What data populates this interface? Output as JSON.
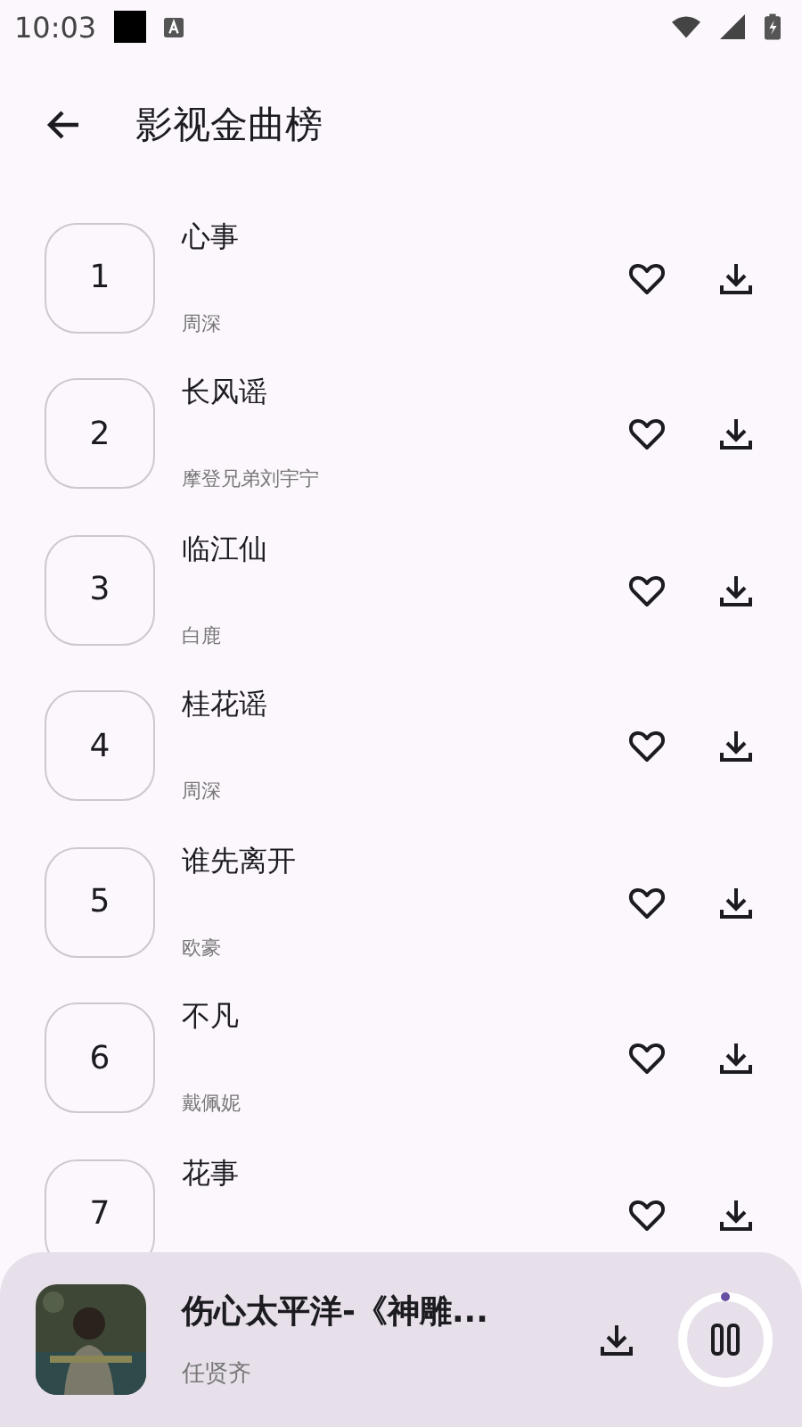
{
  "status_bar": {
    "time": "10:03"
  },
  "header": {
    "title": "影视金曲榜"
  },
  "songs": [
    {
      "rank": "1",
      "title": "心事",
      "artist": "周深"
    },
    {
      "rank": "2",
      "title": "长风谣",
      "artist": "摩登兄弟刘宇宁"
    },
    {
      "rank": "3",
      "title": "临江仙",
      "artist": "白鹿"
    },
    {
      "rank": "4",
      "title": "桂花谣",
      "artist": "周深"
    },
    {
      "rank": "5",
      "title": "谁先离开",
      "artist": "欧豪"
    },
    {
      "rank": "6",
      "title": "不凡",
      "artist": "戴佩妮"
    },
    {
      "rank": "7",
      "title": "花事"
    }
  ],
  "player": {
    "title": "伤心太平洋-《神雕...",
    "artist": "任贤齐"
  }
}
